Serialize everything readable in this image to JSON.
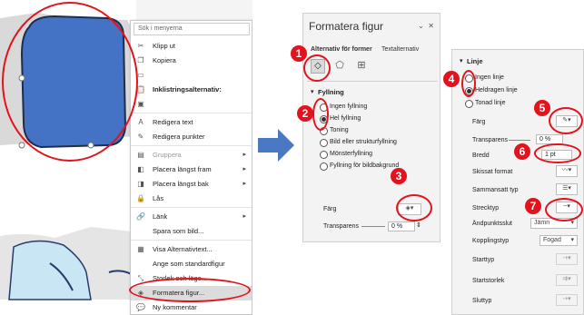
{
  "context_menu": {
    "search_placeholder": "Sök i menyerna",
    "items": [
      {
        "label": "Klipp ut",
        "icon": "scissors-icon"
      },
      {
        "label": "Kopiera",
        "icon": "copy-icon"
      },
      {
        "label": "",
        "icon": "paste-icon"
      },
      {
        "label": "Inklistringsalternativ:",
        "icon": "clipboard-icon"
      },
      {
        "label": "Redigera text",
        "icon": "edit-text-icon"
      },
      {
        "label": "Redigera punkter",
        "icon": "edit-points-icon"
      },
      {
        "label": "Gruppera",
        "icon": "group-icon"
      },
      {
        "label": "Placera längst fram",
        "icon": "bring-front-icon"
      },
      {
        "label": "Placera längst bak",
        "icon": "send-back-icon"
      },
      {
        "label": "Lås",
        "icon": "lock-icon"
      },
      {
        "label": "Länk",
        "icon": "link-icon"
      },
      {
        "label": "Spara som bild...",
        "icon": ""
      },
      {
        "label": "Visa Alternativtext...",
        "icon": "alt-text-icon"
      },
      {
        "label": "Ange som standardfigur",
        "icon": ""
      },
      {
        "label": "Storlek och läge...",
        "icon": "size-position-icon"
      },
      {
        "label": "Formatera figur...",
        "icon": "format-shape-icon"
      },
      {
        "label": "Ny kommentar",
        "icon": "comment-icon"
      }
    ]
  },
  "format_pane": {
    "title": "Formatera figur",
    "tab_shape_options": "Alternativ för former",
    "tab_text_options": "Textalternativ",
    "fill_section": "Fyllning",
    "fill_options": [
      "Ingen fyllning",
      "Hel fyllning",
      "Toning",
      "Bild eller strukturfyllning",
      "Mönsterfyllning",
      "Fyllning för bildbakgrund"
    ],
    "color_label": "Färg",
    "transparency_label": "Transparens",
    "transparency_value": "0 %"
  },
  "line_pane": {
    "section": "Linje",
    "line_options": [
      "Ingen linje",
      "Heldragen linje",
      "Tonad linje"
    ],
    "color_label": "Färg",
    "transparency_label": "Transparens",
    "transparency_value": "0 %",
    "width_label": "Bredd",
    "width_value": "1 pt",
    "sketch_label": "Skissat format",
    "compound_label": "Sammansatt typ",
    "dash_label": "Strecktyp",
    "cap_label": "Ändpunktsslut",
    "cap_value": "Jämn",
    "join_label": "Kopplingstyp",
    "join_value": "Fogad",
    "begin_type_label": "Starttyp",
    "begin_size_label": "Startstorlek",
    "end_type_label": "Sluttyp"
  },
  "callouts": [
    "1",
    "2",
    "3",
    "4",
    "5",
    "6",
    "7"
  ],
  "colors": {
    "shape_fill": "#4472c4",
    "callout_red": "#e2131d",
    "arrow_blue": "#4a78c2"
  }
}
